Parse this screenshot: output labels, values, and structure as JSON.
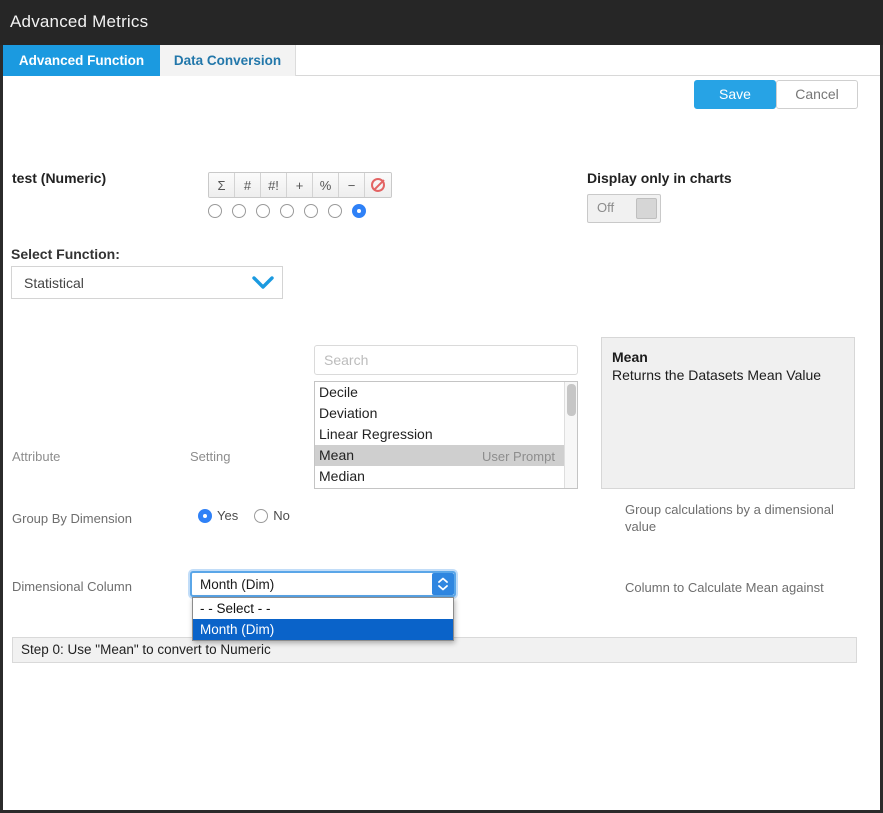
{
  "window": {
    "title": "Advanced Metrics"
  },
  "tabs": [
    {
      "label": "Advanced Function",
      "active": true
    },
    {
      "label": "Data Conversion",
      "active": false
    }
  ],
  "actions": {
    "save_label": "Save",
    "cancel_label": "Cancel"
  },
  "metric": {
    "name": "test (Numeric)",
    "format_buttons": [
      {
        "icon": "sigma-icon",
        "glyph": "Σ"
      },
      {
        "icon": "hash-icon",
        "glyph": "#"
      },
      {
        "icon": "hash-bang-icon",
        "glyph": "#!"
      },
      {
        "icon": "plus-icon",
        "glyph": "+"
      },
      {
        "icon": "percent-icon",
        "glyph": "%"
      },
      {
        "icon": "minus-icon",
        "glyph": "−"
      },
      {
        "icon": "no-format-icon",
        "glyph": ""
      }
    ],
    "format_selected_index": 6
  },
  "display_only_in_charts": {
    "label": "Display only in charts",
    "state_label": "Off",
    "on": false
  },
  "select_function": {
    "label": "Select Function:",
    "value": "Statistical",
    "chevron_icon": "chevron-down-icon",
    "accent": "#1b9ae0"
  },
  "function_search": {
    "placeholder": "Search",
    "value": ""
  },
  "function_list": {
    "items": [
      "Decile",
      "Deviation",
      "Linear Regression",
      "Mean",
      "Median"
    ],
    "selected": "Mean"
  },
  "function_description": {
    "title": "Mean",
    "body": "Returns the Datasets Mean Value"
  },
  "attribute_table": {
    "headers": [
      "Attribute",
      "Setting",
      "User Prompt"
    ],
    "rows": [
      {
        "attribute": "Group By Dimension",
        "setting_type": "radio",
        "options": [
          "Yes",
          "No"
        ],
        "selected": "Yes",
        "prompt": "Group calculations by a dimensional value"
      },
      {
        "attribute": "Dimensional Column",
        "setting_type": "select",
        "value": "Month (Dim)",
        "options": [
          "- - Select - -",
          "Month (Dim)"
        ],
        "highlighted_option": "Month (Dim)",
        "open": true,
        "prompt": "Column to Calculate Mean against"
      }
    ]
  },
  "steps": [
    {
      "text": "Step 0:  Use \"Mean\" to convert to Numeric"
    }
  ]
}
